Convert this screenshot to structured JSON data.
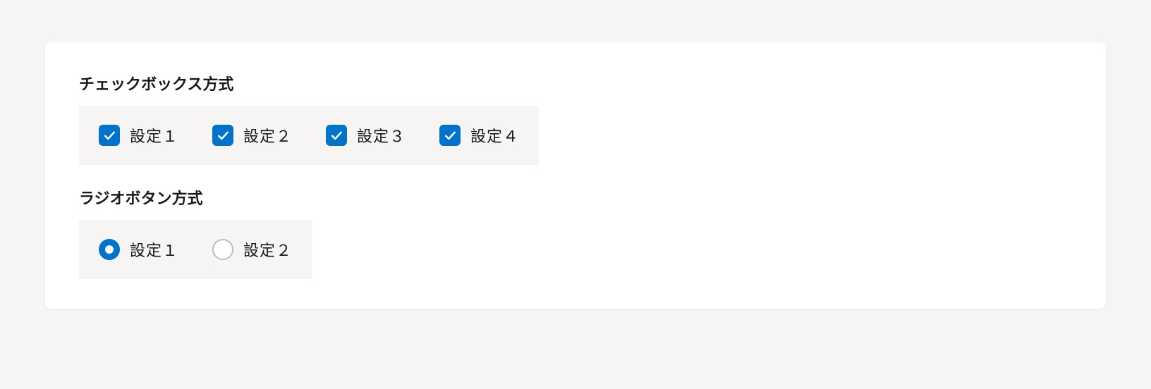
{
  "checkbox_section": {
    "title": "チェックボックス方式",
    "options": [
      {
        "label": "設定１",
        "checked": true
      },
      {
        "label": "設定２",
        "checked": true
      },
      {
        "label": "設定３",
        "checked": true
      },
      {
        "label": "設定４",
        "checked": true
      }
    ]
  },
  "radio_section": {
    "title": "ラジオボタン方式",
    "options": [
      {
        "label": "設定１",
        "checked": true
      },
      {
        "label": "設定２",
        "checked": false
      }
    ]
  }
}
